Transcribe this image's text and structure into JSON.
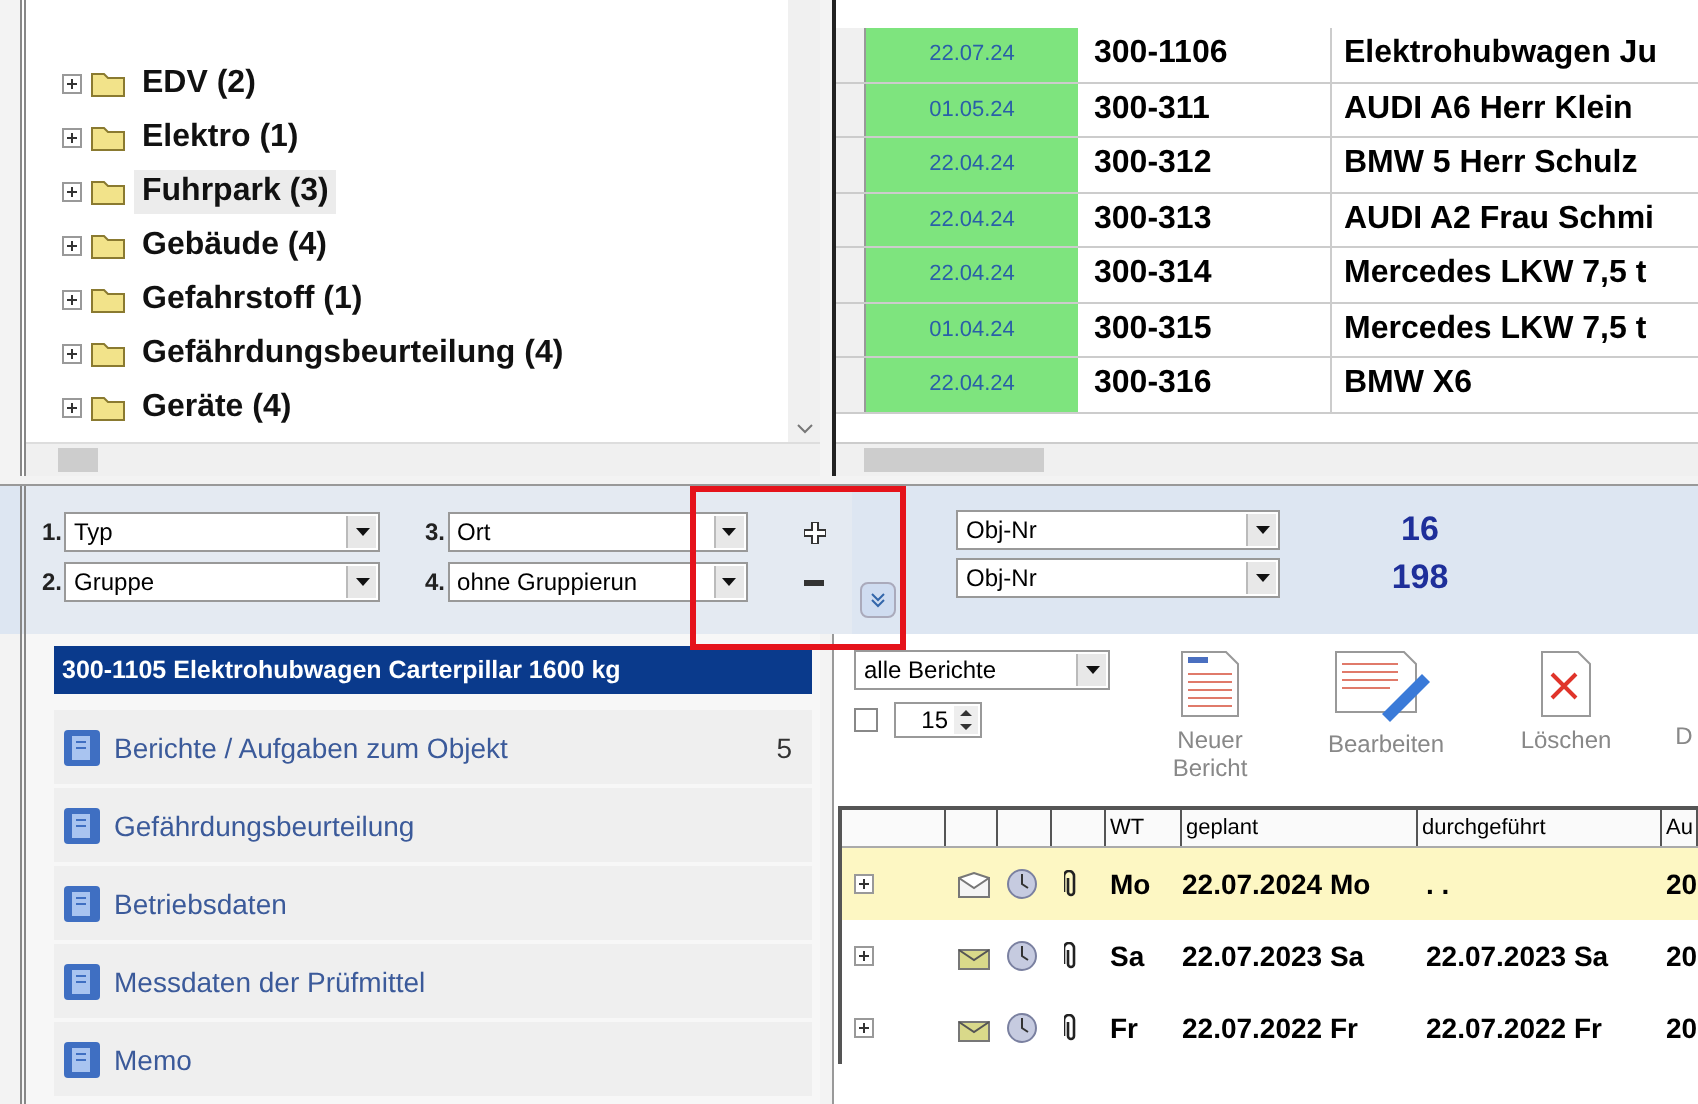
{
  "tree": {
    "items": [
      {
        "label": "EDV (2)",
        "selected": false
      },
      {
        "label": "Elektro (1)",
        "selected": false
      },
      {
        "label": "Fuhrpark (3)",
        "selected": true
      },
      {
        "label": "Gebäude (4)",
        "selected": false
      },
      {
        "label": "Gefahrstoff (1)",
        "selected": false
      },
      {
        "label": "Gefährdungsbeurteilung (4)",
        "selected": false
      },
      {
        "label": "Geräte (4)",
        "selected": false
      }
    ]
  },
  "objects": {
    "rows": [
      {
        "date": "22.07.24",
        "number": "300-1106",
        "name": "Elektrohubwagen Ju"
      },
      {
        "date": "01.05.24",
        "number": "300-311",
        "name": "AUDI A6 Herr Klein"
      },
      {
        "date": "22.04.24",
        "number": "300-312",
        "name": "BMW 5 Herr Schulz"
      },
      {
        "date": "22.04.24",
        "number": "300-313",
        "name": "AUDI A2 Frau Schmi"
      },
      {
        "date": "22.04.24",
        "number": "300-314",
        "name": "Mercedes LKW 7,5 t"
      },
      {
        "date": "01.04.24",
        "number": "300-315",
        "name": "Mercedes LKW 7,5 t"
      },
      {
        "date": "22.04.24",
        "number": "300-316",
        "name": "BMW X6"
      }
    ]
  },
  "grouping": {
    "fields": [
      {
        "index": "1.",
        "value": "Typ"
      },
      {
        "index": "3.",
        "value": "Ort"
      },
      {
        "index": "2.",
        "value": "Gruppe"
      },
      {
        "index": "4.",
        "value": "ohne Gruppierun"
      }
    ],
    "sort_fields": [
      {
        "value": "Obj-Nr",
        "count": "16"
      },
      {
        "value": "Obj-Nr",
        "count": "198"
      }
    ]
  },
  "detail": {
    "title": "300-1105 Elektrohubwagen Carterpillar 1600 kg",
    "items": [
      {
        "label": "Berichte / Aufgaben zum Objekt",
        "count": "5"
      },
      {
        "label": "Gefährdungsbeurteilung"
      },
      {
        "label": "Betriebsdaten"
      },
      {
        "label": "Messdaten der Prüfmittel"
      },
      {
        "label": "Memo"
      }
    ]
  },
  "reports": {
    "filter": "alle Berichte",
    "limit_checked": false,
    "limit": "15",
    "toolbar": [
      {
        "kind": "new",
        "label": "Neuer Bericht",
        "disabled": true
      },
      {
        "kind": "edit",
        "label": "Bearbeiten",
        "disabled": true
      },
      {
        "kind": "delete",
        "label": "Löschen",
        "disabled": true
      },
      {
        "kind": "more",
        "label": "D",
        "disabled": true
      }
    ],
    "columns": [
      "WT",
      "geplant",
      "durchgeführt",
      "Au"
    ],
    "rows": [
      {
        "selected": true,
        "kind": "open",
        "wt": "Mo",
        "planned": "22.07.2024 Mo",
        "done": ". .",
        "au": "20"
      },
      {
        "selected": false,
        "kind": "sent",
        "wt": "Sa",
        "planned": "22.07.2023 Sa",
        "done": "22.07.2023 Sa",
        "au": "20"
      },
      {
        "selected": false,
        "kind": "sent",
        "wt": "Fr",
        "planned": "22.07.2022 Fr",
        "done": "22.07.2022 Fr",
        "au": "20"
      }
    ]
  }
}
